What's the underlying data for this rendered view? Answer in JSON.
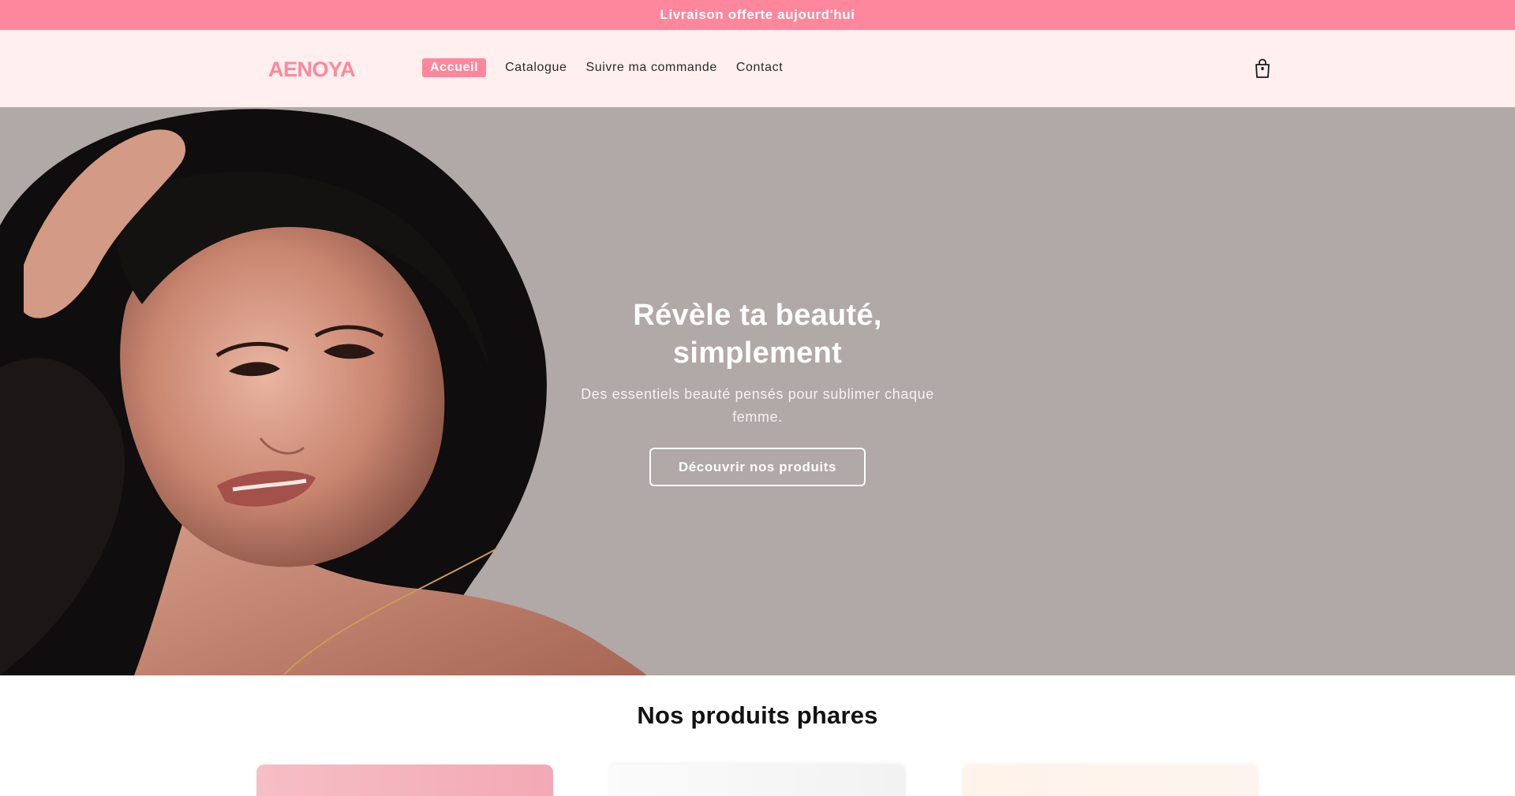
{
  "announcement": {
    "text": "Livraison offerte aujourd'hui"
  },
  "header": {
    "logo_text": "AENOYA",
    "nav": [
      {
        "label": "Accueil",
        "active": true
      },
      {
        "label": "Catalogue",
        "active": false
      },
      {
        "label": "Suivre ma commande",
        "active": false
      },
      {
        "label": "Contact",
        "active": false
      }
    ],
    "cart_icon": "shopping-bag-icon"
  },
  "hero": {
    "title_line1": "Révèle ta beauté,",
    "title_line2": "simplement",
    "subtitle": "Des essentiels beauté pensés pour sublimer chaque femme.",
    "cta_label": "Découvrir nos produits"
  },
  "featured": {
    "title": "Nos produits phares"
  },
  "colors": {
    "accent": "#ff879d",
    "header_bg": "#ffefef",
    "hero_bg": "#b1a8a8"
  }
}
